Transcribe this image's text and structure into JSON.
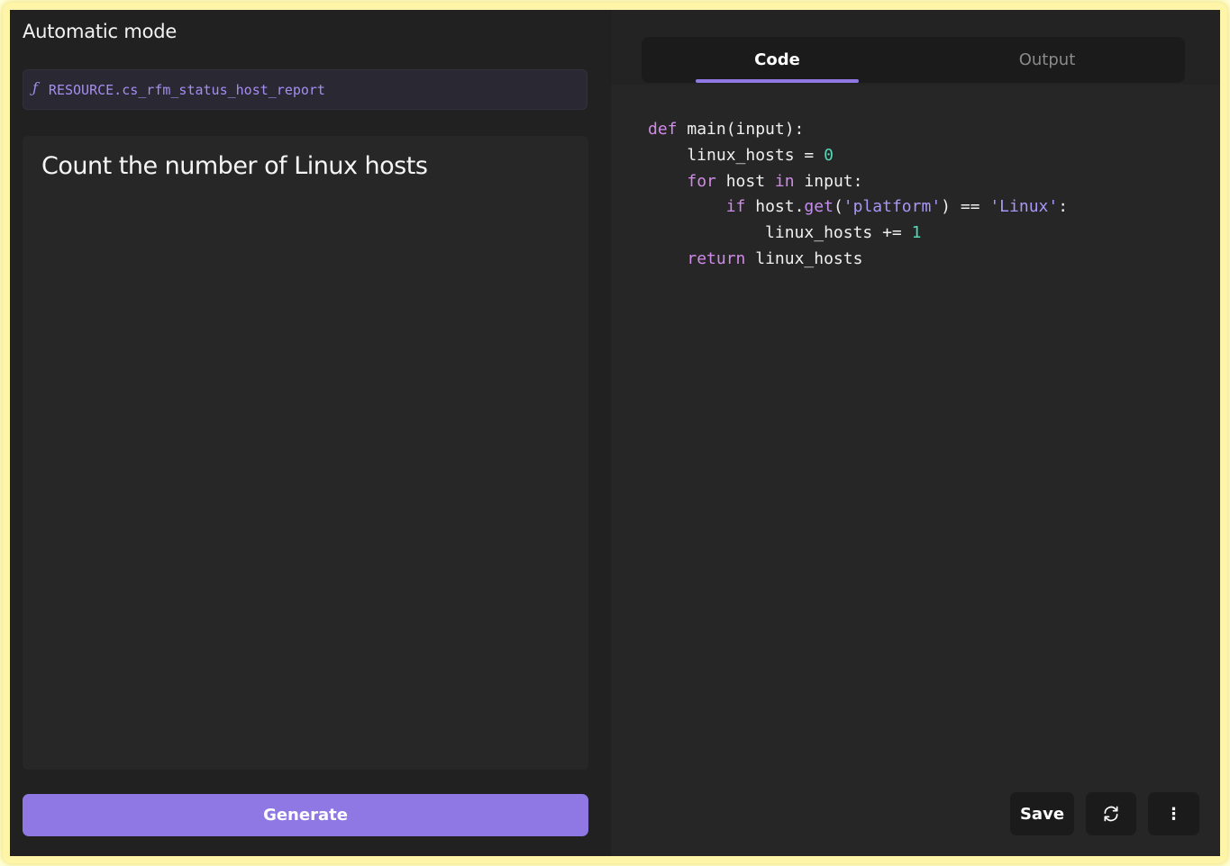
{
  "left_panel": {
    "title": "Automatic mode",
    "resource": {
      "icon": "function-icon",
      "icon_glyph": "ƒ",
      "value": "RESOURCE.cs_rfm_status_host_report"
    },
    "prompt": "Count the number of Linux hosts",
    "generate_label": "Generate"
  },
  "right_panel": {
    "tabs": [
      {
        "label": "Code",
        "active": true
      },
      {
        "label": "Output",
        "active": false
      }
    ],
    "code_lines": [
      [
        {
          "t": "kw",
          "v": "def"
        },
        {
          "t": "plain",
          "v": " main(input):"
        }
      ],
      [
        {
          "t": "plain",
          "v": "    linux_hosts = "
        },
        {
          "t": "num",
          "v": "0"
        }
      ],
      [
        {
          "t": "plain",
          "v": "    "
        },
        {
          "t": "kw",
          "v": "for"
        },
        {
          "t": "plain",
          "v": " host "
        },
        {
          "t": "kw",
          "v": "in"
        },
        {
          "t": "plain",
          "v": " input:"
        }
      ],
      [
        {
          "t": "plain",
          "v": "        "
        },
        {
          "t": "kw",
          "v": "if"
        },
        {
          "t": "plain",
          "v": " host."
        },
        {
          "t": "fn",
          "v": "get"
        },
        {
          "t": "plain",
          "v": "("
        },
        {
          "t": "str",
          "v": "'platform'"
        },
        {
          "t": "plain",
          "v": ") == "
        },
        {
          "t": "str",
          "v": "'Linux'"
        },
        {
          "t": "plain",
          "v": ":"
        }
      ],
      [
        {
          "t": "plain",
          "v": "            linux_hosts += "
        },
        {
          "t": "num",
          "v": "1"
        }
      ],
      [
        {
          "t": "plain",
          "v": "    "
        },
        {
          "t": "kw",
          "v": "return"
        },
        {
          "t": "plain",
          "v": " linux_hosts"
        }
      ]
    ],
    "toolbar": {
      "save_label": "Save",
      "refresh_icon": "refresh-icon",
      "more_icon": "more-vertical-icon",
      "more_glyph": "⋮"
    }
  },
  "colors": {
    "accent": "#8f78e3",
    "background": "#1f1f1f",
    "keyword": "#d08be8",
    "string": "#a996f5",
    "number": "#57d6b4"
  }
}
